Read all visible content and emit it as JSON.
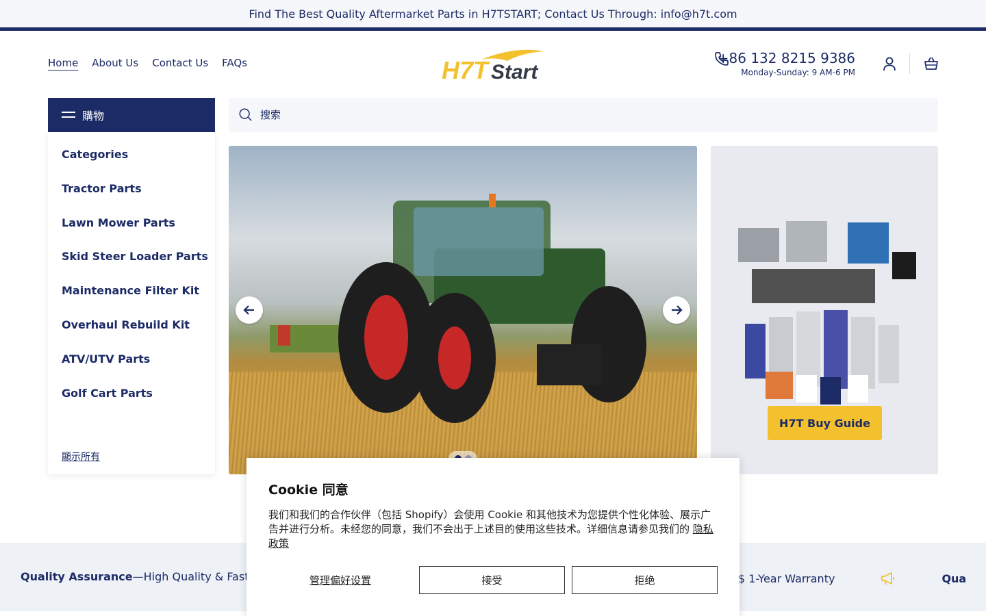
{
  "announcement": {
    "text": "Find The Best Quality Aftermarket Parts in H7TSTART; Contact Us Through: info@h7t.com"
  },
  "nav": {
    "items": [
      {
        "label": "Home"
      },
      {
        "label": "About Us"
      },
      {
        "label": "Contact Us"
      },
      {
        "label": "FAQs"
      }
    ]
  },
  "logo": {
    "text_a": "H7T",
    "text_b": "Start"
  },
  "contact": {
    "phone": "+86 132 8215 9386",
    "hours": "Monday-Sunday: 9 AM-6 PM"
  },
  "sidebar": {
    "header_label": "購物",
    "categories": [
      {
        "label": "Categories"
      },
      {
        "label": "Tractor Parts"
      },
      {
        "label": "Lawn Mower Parts"
      },
      {
        "label": "Skid Steer Loader Parts"
      },
      {
        "label": "Maintenance Filter Kit"
      },
      {
        "label": "Overhaul Rebuild Kit"
      },
      {
        "label": "ATV/UTV Parts"
      },
      {
        "label": "Golf Cart Parts"
      }
    ],
    "show_all": "顯示所有"
  },
  "search": {
    "placeholder": "搜索"
  },
  "promo": {
    "button_label": "H7T Buy Guide"
  },
  "marquee": {
    "strong": "Quality Assurance",
    "dash": " — ",
    "text": "High Quality & Fast S",
    "tail_text": "ping $ 1-Year Warranty",
    "tail_strong": "Qua"
  },
  "cookie": {
    "title": "Cookie 同意",
    "body": "我们和我们的合作伙伴（包括 Shopify）会使用 Cookie 和其他技术为您提供个性化体验、展示广告并进行分析。未经您的同意，我们不会出于上述目的使用这些技术。详细信息请参见我们的",
    "link": "隐私政策",
    "manage": "管理偏好设置",
    "accept": "接受",
    "reject": "拒绝"
  },
  "colors": {
    "brand_navy": "#1c2b66",
    "accent_yellow": "#f4c12e"
  }
}
